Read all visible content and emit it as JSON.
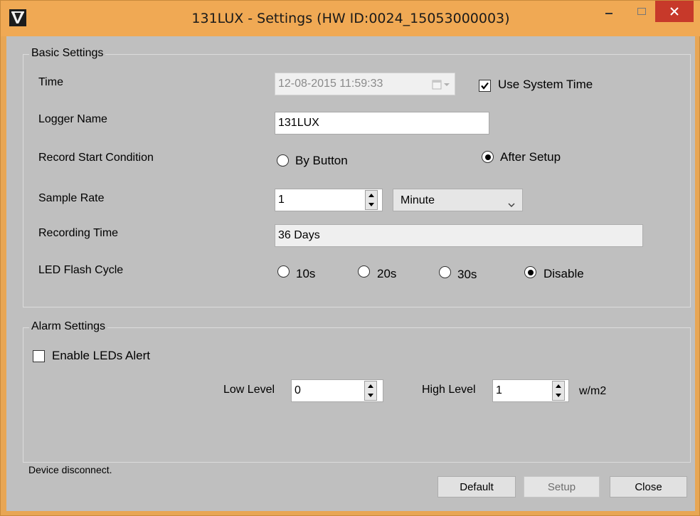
{
  "window": {
    "title": "131LUX - Settings (HW ID:0024_15053000003)",
    "minimize_label": "_",
    "maximize_label": "□",
    "close_label": "×"
  },
  "basic": {
    "legend": "Basic Settings",
    "time_label": "Time",
    "time_value": "12-08-2015  11:59:33",
    "use_system_time_label": "Use System Time",
    "use_system_time_checked": true,
    "logger_name_label": "Logger Name",
    "logger_name_value": "131LUX",
    "record_start_label": "Record Start Condition",
    "by_button_label": "By Button",
    "after_setup_label": "After Setup",
    "record_start_selected": "After Setup",
    "sample_rate_label": "Sample Rate",
    "sample_rate_value": "1",
    "sample_rate_unit": "Minute",
    "recording_time_label": "Recording Time",
    "recording_time_value": "36 Days",
    "led_flash_label": "LED Flash Cycle",
    "led_options": [
      "10s",
      "20s",
      "30s",
      "Disable"
    ],
    "led_selected": "Disable"
  },
  "alarm": {
    "legend": "Alarm Settings",
    "enable_leds_label": "Enable LEDs Alert",
    "enable_leds_checked": false,
    "low_level_label": "Low Level",
    "low_level_value": "0",
    "high_level_label": "High Level",
    "high_level_value": "1",
    "unit_label": "w/m2"
  },
  "status": {
    "text": "Device disconnect."
  },
  "buttons": {
    "default_label": "Default",
    "setup_label": "Setup",
    "close_label": "Close"
  },
  "colors": {
    "titlebar": "#f0a954",
    "client": "#bfbfbf",
    "close_button": "#c7392a"
  }
}
